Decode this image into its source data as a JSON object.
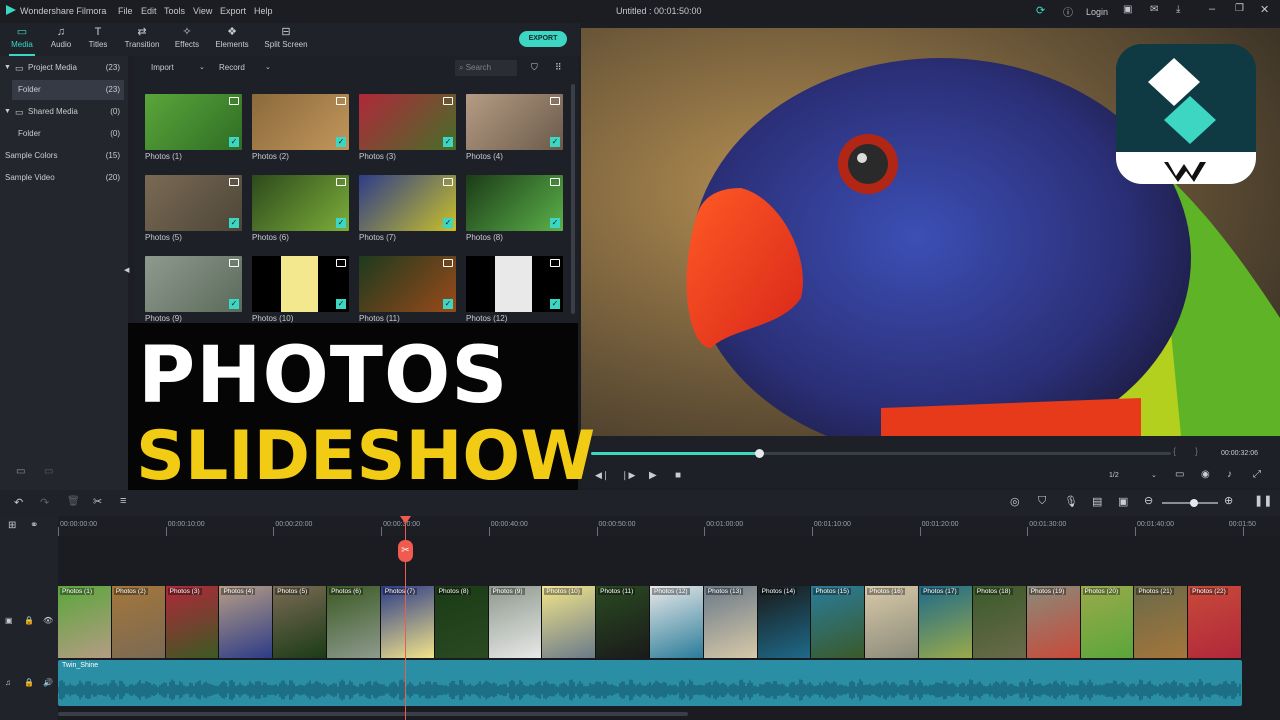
{
  "app": {
    "name": "Wondershare Filmora",
    "window_title": "Untitled : 00:01:50:00",
    "login": "Login"
  },
  "menu": [
    "File",
    "Edit",
    "Tools",
    "View",
    "Export",
    "Help"
  ],
  "tabs": [
    {
      "label": "Media",
      "icon": "folder-icon",
      "active": true
    },
    {
      "label": "Audio",
      "icon": "music-note-icon"
    },
    {
      "label": "Titles",
      "icon": "text-t-icon"
    },
    {
      "label": "Transition",
      "icon": "transition-icon"
    },
    {
      "label": "Effects",
      "icon": "effects-icon"
    },
    {
      "label": "Elements",
      "icon": "elements-icon"
    },
    {
      "label": "Split Screen",
      "icon": "split-screen-icon"
    }
  ],
  "export_label": "EXPORT",
  "sidebar": {
    "items": [
      {
        "label": "Project Media",
        "count": "(23)"
      },
      {
        "label": "Folder",
        "count": "(23)"
      },
      {
        "label": "Shared Media",
        "count": "(0)"
      },
      {
        "label": "Folder",
        "count": "(0)"
      },
      {
        "label": "Sample Colors",
        "count": "(15)"
      },
      {
        "label": "Sample Video",
        "count": "(20)"
      }
    ]
  },
  "media_toolbar": {
    "import": "Import",
    "record": "Record",
    "search_placeholder": "Search"
  },
  "media": [
    "Photos (1)",
    "Photos (2)",
    "Photos (3)",
    "Photos (4)",
    "Photos (5)",
    "Photos (6)",
    "Photos (7)",
    "Photos (8)",
    "Photos (9)",
    "Photos (10)",
    "Photos (11)",
    "Photos (12)"
  ],
  "banner": {
    "line1": "PHOTOS",
    "line2": "SLIDESHOW"
  },
  "player": {
    "timecode": "00:00:32:06",
    "quality": "1/2",
    "progress": 0.29
  },
  "ruler": [
    "00:00:00:00",
    "00:00:10:00",
    "00:00:20:00",
    "00:00:30:00",
    "00:00:40:00",
    "00:00:50:00",
    "00:01:00:00",
    "00:01:10:00",
    "00:01:20:00",
    "00:01:30:00",
    "00:01:40:00",
    "00:01:50"
  ],
  "clips": [
    "Photos (1)",
    "Photos (2)",
    "Photos (3)",
    "Photos (4)",
    "Photos (5)",
    "Photos (6)",
    "Photos (7)",
    "Photos (8)",
    "Photos (9)",
    "Photos (10)",
    "Photos (11)",
    "Photos (12)",
    "Photos (13)",
    "Photos (14)",
    "Photos (15)",
    "Photos (16)",
    "Photos (17)",
    "Photos (18)",
    "Photos (19)",
    "Photos (20)",
    "Photos (21)",
    "Photos (22)"
  ],
  "audio_track": "Twin_Shine",
  "colors": {
    "accent": "#3cd6c3",
    "playhead": "#f05a4f",
    "audio": "#2a8fa5",
    "banner_yellow": "#f2cc14"
  }
}
